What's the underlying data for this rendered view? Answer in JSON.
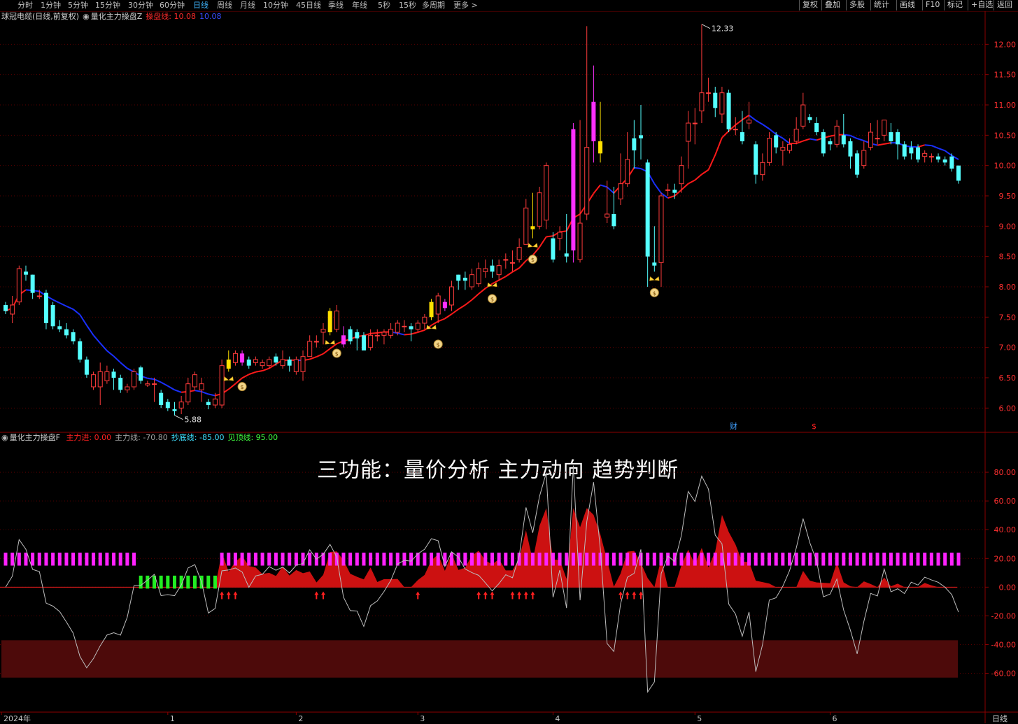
{
  "toolbar": {
    "periods": [
      "分时",
      "1分钟",
      "5分钟",
      "15分钟",
      "30分钟",
      "60分钟",
      "日线",
      "周线",
      "月线",
      "10分钟",
      "45日线",
      "季线",
      "年线",
      "5秒",
      "15秒",
      "多周期",
      "更多 >"
    ],
    "active_period": "日线",
    "buttons": [
      "复权",
      "叠加",
      "多股",
      "统计",
      "画线",
      "F10",
      "标记",
      "+自选",
      "返回"
    ]
  },
  "main_legend": {
    "stock": "球冠电缆(日线,前复权)",
    "indicator": "量化主力操盘Z",
    "line_label": "操盘线: 10.08",
    "line_value2": "10.08"
  },
  "sub_legend": {
    "indicator": "量化主力操盘F",
    "items": [
      {
        "label": "主力进: 0.00",
        "color": "#ff2020"
      },
      {
        "label": "主力线: -70.80",
        "color": "#a0a0a0"
      },
      {
        "label": "抄底线: -85.00",
        "color": "#40e0ff"
      },
      {
        "label": "见顶线: 95.00",
        "color": "#40ff40"
      }
    ]
  },
  "overlay_title": "三功能：量价分析 主力动向 趋势判断",
  "bottom_right_label": "日线",
  "chart_data": {
    "type": "candlestick",
    "price_axis": {
      "ticks": [
        12.0,
        11.5,
        11.0,
        10.5,
        10.0,
        9.5,
        9.0,
        8.5,
        8.0,
        7.5,
        7.0,
        6.5,
        6.0
      ],
      "ylim": [
        5.6,
        12.5
      ]
    },
    "indicator_axis": {
      "ticks": [
        80.0,
        60.0,
        40.0,
        20.0,
        0.0,
        -20.0,
        -40.0,
        -60.0
      ],
      "ylim": [
        -87,
        100
      ]
    },
    "x_labels": [
      {
        "label": "2024年",
        "i": 0
      },
      {
        "label": "1",
        "i": 24
      },
      {
        "label": "2",
        "i": 42
      },
      {
        "label": "3",
        "i": 60
      },
      {
        "label": "4",
        "i": 80
      },
      {
        "label": "5",
        "i": 101
      },
      {
        "label": "6",
        "i": 120
      }
    ],
    "annotations": [
      {
        "text": "12.33",
        "type": "high"
      },
      {
        "text": "5.88",
        "type": "low"
      }
    ],
    "markers_text": [
      "财",
      "$"
    ],
    "candles": [
      [
        7.7,
        7.6,
        7.75,
        7.55
      ],
      [
        7.55,
        7.7,
        7.85,
        7.4
      ],
      [
        7.75,
        8.3,
        8.35,
        7.7
      ],
      [
        8.25,
        8.2,
        8.35,
        8.1
      ],
      [
        8.2,
        7.9,
        8.2,
        7.8
      ],
      [
        7.85,
        7.85,
        7.95,
        7.8
      ],
      [
        7.9,
        7.4,
        7.95,
        7.3
      ],
      [
        7.7,
        7.35,
        7.75,
        7.3
      ],
      [
        7.35,
        7.3,
        7.45,
        7.25
      ],
      [
        7.3,
        7.2,
        7.4,
        7.15
      ],
      [
        7.25,
        7.1,
        7.3,
        7.05
      ],
      [
        7.1,
        6.8,
        7.15,
        6.75
      ],
      [
        6.8,
        6.55,
        6.85,
        6.5
      ],
      [
        6.35,
        6.55,
        6.6,
        6.3
      ],
      [
        6.35,
        6.6,
        6.75,
        6.05
      ],
      [
        6.45,
        6.6,
        6.7,
        6.4
      ],
      [
        6.6,
        6.5,
        6.65,
        6.3
      ],
      [
        6.5,
        6.3,
        6.55,
        6.25
      ],
      [
        6.3,
        6.35,
        6.4,
        6.25
      ],
      [
        6.35,
        6.6,
        6.65,
        6.3
      ],
      [
        6.67,
        6.45,
        6.7,
        6.4
      ],
      [
        6.38,
        6.4,
        6.45,
        6.35
      ],
      [
        6.4,
        6.4,
        6.5,
        6.1
      ],
      [
        6.25,
        6.05,
        6.3,
        6.0
      ],
      [
        6.1,
        6.0,
        6.15,
        5.95
      ],
      [
        5.98,
        5.95,
        6.1,
        5.88
      ],
      [
        6.0,
        6.1,
        6.2,
        5.9
      ],
      [
        6.1,
        6.4,
        6.5,
        6.05
      ],
      [
        6.35,
        6.55,
        6.6,
        6.3
      ],
      [
        6.3,
        6.4,
        6.5,
        6.1
      ],
      [
        6.1,
        6.05,
        6.15,
        5.98
      ],
      [
        6.05,
        6.15,
        6.25,
        6.0
      ],
      [
        6.05,
        6.7,
        6.8,
        6.0
      ],
      [
        6.65,
        6.8,
        6.95,
        6.6
      ],
      [
        6.75,
        6.9,
        6.95,
        6.7
      ],
      [
        6.75,
        6.9,
        6.95,
        6.7
      ],
      [
        6.8,
        6.7,
        6.85,
        6.65
      ],
      [
        6.75,
        6.8,
        6.85,
        6.7
      ],
      [
        6.7,
        6.75,
        6.8,
        6.65
      ],
      [
        6.7,
        6.8,
        6.85,
        6.65
      ],
      [
        6.85,
        6.75,
        6.9,
        6.7
      ],
      [
        6.7,
        6.8,
        6.95,
        6.65
      ],
      [
        6.8,
        6.7,
        6.85,
        6.6
      ],
      [
        6.6,
        6.8,
        6.85,
        6.55
      ],
      [
        6.6,
        6.85,
        6.95,
        6.45
      ],
      [
        6.85,
        7.1,
        7.2,
        6.85
      ],
      [
        7.1,
        7.1,
        7.2,
        7.0
      ],
      [
        7.25,
        7.3,
        7.4,
        7.05
      ],
      [
        7.25,
        7.6,
        7.65,
        7.2
      ],
      [
        7.3,
        7.6,
        7.7,
        7.25
      ],
      [
        7.05,
        7.2,
        7.35,
        7.0
      ],
      [
        7.3,
        7.1,
        7.35,
        7.05
      ],
      [
        7.25,
        7.15,
        7.3,
        6.95
      ],
      [
        7.2,
        6.95,
        7.25,
        6.95
      ],
      [
        7.0,
        7.2,
        7.3,
        6.95
      ],
      [
        7.2,
        7.2,
        7.3,
        7.1
      ],
      [
        7.2,
        7.25,
        7.3,
        7.05
      ],
      [
        7.2,
        7.3,
        7.4,
        7.15
      ],
      [
        7.25,
        7.4,
        7.45,
        7.2
      ],
      [
        7.35,
        7.35,
        7.45,
        7.25
      ],
      [
        7.35,
        7.3,
        7.4,
        7.1
      ],
      [
        7.3,
        7.4,
        7.45,
        7.25
      ],
      [
        7.4,
        7.5,
        7.55,
        7.3
      ],
      [
        7.5,
        7.75,
        7.8,
        7.45
      ],
      [
        7.55,
        7.85,
        7.9,
        7.4
      ],
      [
        7.75,
        7.65,
        7.8,
        7.6
      ],
      [
        7.7,
        8.0,
        8.1,
        7.6
      ],
      [
        8.2,
        8.1,
        8.2,
        7.95
      ],
      [
        8.15,
        8.1,
        8.25,
        7.95
      ],
      [
        8.0,
        8.2,
        8.3,
        7.95
      ],
      [
        8.05,
        8.3,
        8.4,
        8.0
      ],
      [
        8.25,
        8.3,
        8.45,
        8.15
      ],
      [
        8.35,
        8.25,
        8.45,
        8.15
      ],
      [
        8.2,
        8.35,
        8.45,
        8.1
      ],
      [
        8.45,
        8.45,
        8.55,
        8.3
      ],
      [
        8.4,
        8.4,
        8.6,
        8.25
      ],
      [
        8.45,
        8.65,
        8.8,
        8.4
      ],
      [
        8.7,
        9.3,
        9.45,
        8.7
      ],
      [
        8.95,
        9.0,
        9.55,
        8.8
      ],
      [
        9.0,
        9.55,
        9.65,
        8.95
      ],
      [
        9.1,
        10.0,
        10.05,
        8.95
      ],
      [
        8.8,
        8.45,
        8.9,
        8.4
      ],
      [
        8.8,
        8.9,
        9.0,
        8.6
      ],
      [
        8.55,
        8.5,
        9.2,
        8.4
      ],
      [
        8.6,
        10.6,
        10.7,
        8.4
      ],
      [
        8.45,
        9.05,
        10.75,
        8.4
      ],
      [
        9.2,
        10.3,
        12.3,
        9.1
      ],
      [
        10.4,
        11.05,
        11.65,
        10.05
      ],
      [
        10.2,
        10.4,
        11.05,
        10.05
      ],
      [
        9.15,
        9.2,
        9.75,
        9.05
      ],
      [
        9.2,
        9.0,
        9.65,
        8.95
      ],
      [
        9.45,
        9.7,
        10.2,
        9.35
      ],
      [
        9.7,
        10.1,
        10.55,
        9.65
      ],
      [
        10.45,
        10.25,
        10.75,
        9.95
      ],
      [
        10.5,
        10.45,
        11.0,
        10.1
      ],
      [
        10.05,
        8.5,
        10.1,
        8.0
      ],
      [
        8.4,
        8.35,
        9.0,
        8.25
      ],
      [
        8.4,
        9.5,
        9.55,
        8.0
      ],
      [
        9.6,
        9.6,
        9.7,
        9.5
      ],
      [
        9.6,
        9.55,
        9.7,
        9.45
      ],
      [
        9.7,
        10.0,
        10.15,
        9.55
      ],
      [
        10.4,
        10.7,
        10.9,
        9.95
      ],
      [
        10.7,
        10.7,
        10.95,
        10.35
      ],
      [
        10.9,
        11.2,
        12.33,
        10.7
      ],
      [
        11.2,
        11.2,
        11.45,
        11.05
      ]
    ]
  }
}
